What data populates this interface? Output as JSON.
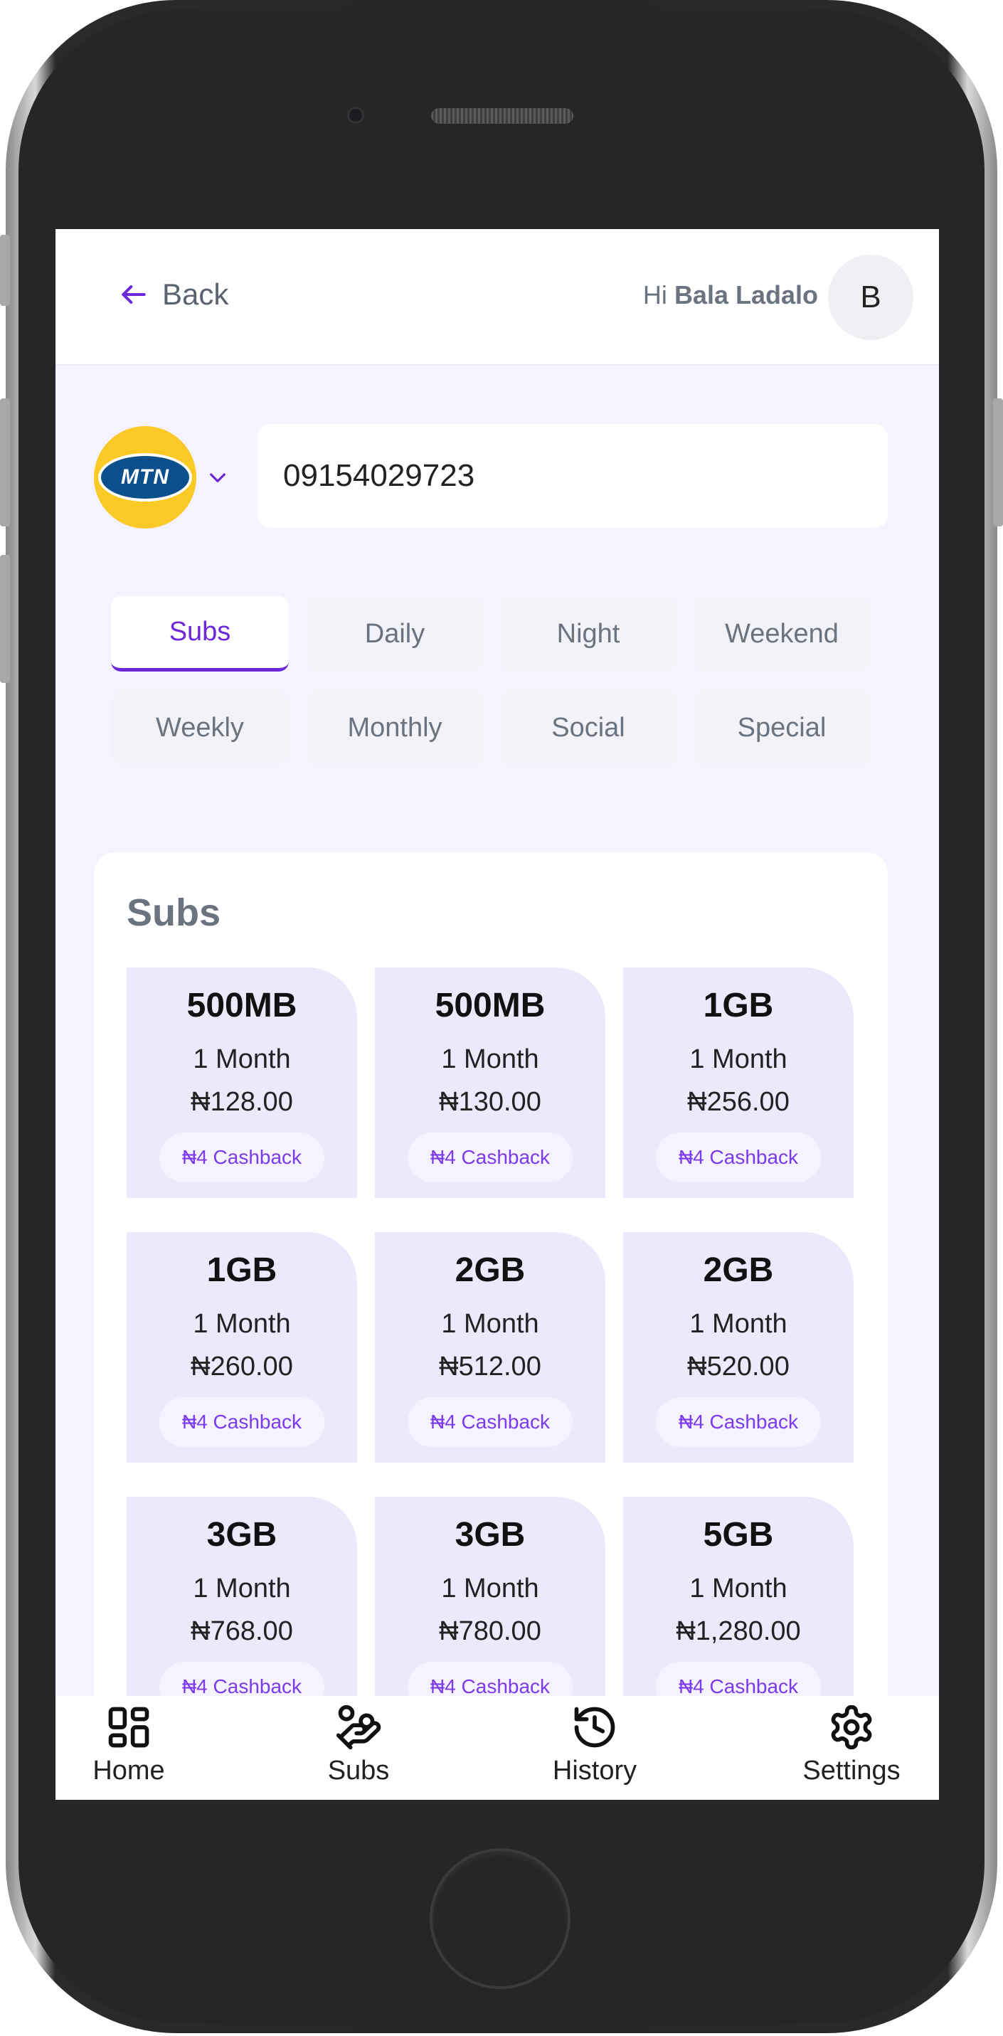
{
  "header": {
    "back_label": "Back",
    "greeting_prefix": "Hi",
    "user_name": "Bala Ladalo",
    "avatar_initial": "B"
  },
  "network": {
    "logo_text": "MTN",
    "phone_number": "09154029723"
  },
  "tabs": [
    {
      "label": "Subs",
      "active": true
    },
    {
      "label": "Daily",
      "active": false
    },
    {
      "label": "Night",
      "active": false
    },
    {
      "label": "Weekend",
      "active": false
    },
    {
      "label": "Weekly",
      "active": false
    },
    {
      "label": "Monthly",
      "active": false
    },
    {
      "label": "Social",
      "active": false
    },
    {
      "label": "Special",
      "active": false
    }
  ],
  "plans_section": {
    "title": "Subs",
    "plans": [
      {
        "size": "500MB",
        "duration": "1 Month",
        "price": "₦128.00",
        "cashback": "₦4 Cashback"
      },
      {
        "size": "500MB",
        "duration": "1 Month",
        "price": "₦130.00",
        "cashback": "₦4 Cashback"
      },
      {
        "size": "1GB",
        "duration": "1 Month",
        "price": "₦256.00",
        "cashback": "₦4 Cashback"
      },
      {
        "size": "1GB",
        "duration": "1 Month",
        "price": "₦260.00",
        "cashback": "₦4 Cashback"
      },
      {
        "size": "2GB",
        "duration": "1 Month",
        "price": "₦512.00",
        "cashback": "₦4 Cashback"
      },
      {
        "size": "2GB",
        "duration": "1 Month",
        "price": "₦520.00",
        "cashback": "₦4 Cashback"
      },
      {
        "size": "3GB",
        "duration": "1 Month",
        "price": "₦768.00",
        "cashback": "₦4 Cashback"
      },
      {
        "size": "3GB",
        "duration": "1 Month",
        "price": "₦780.00",
        "cashback": "₦4 Cashback"
      },
      {
        "size": "5GB",
        "duration": "1 Month",
        "price": "₦1,280.00",
        "cashback": "₦4 Cashback"
      }
    ]
  },
  "bottom_nav": [
    {
      "label": "Home",
      "icon": "grid-icon"
    },
    {
      "label": "Subs",
      "icon": "hand-coins-icon"
    },
    {
      "label": "History",
      "icon": "history-icon"
    },
    {
      "label": "Settings",
      "icon": "gear-icon"
    }
  ],
  "colors": {
    "accent": "#6d28d9",
    "background": "#f5f3ff",
    "plan_card": "#ece9fd",
    "mtn_yellow": "#fbc926",
    "mtn_blue": "#0b4f8c"
  }
}
